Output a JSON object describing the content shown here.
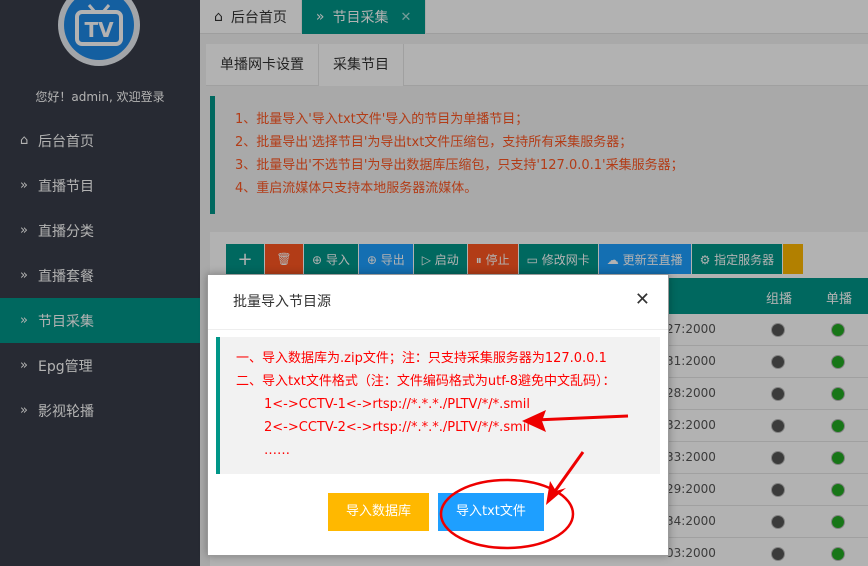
{
  "sidebar": {
    "greeting": "您好！admin, 欢迎登录",
    "items": [
      {
        "label": "后台首页",
        "icon": "home-icon",
        "glyph": "⌂"
      },
      {
        "label": "直播节目",
        "icon": "double-chevron-icon",
        "glyph": "»"
      },
      {
        "label": "直播分类",
        "icon": "double-chevron-icon",
        "glyph": "»"
      },
      {
        "label": "直播套餐",
        "icon": "double-chevron-icon",
        "glyph": "»"
      },
      {
        "label": "节目采集",
        "icon": "double-chevron-icon",
        "glyph": "»",
        "active": true
      },
      {
        "label": "Epg管理",
        "icon": "double-chevron-icon",
        "glyph": "»"
      },
      {
        "label": "影视轮播",
        "icon": "double-chevron-icon",
        "glyph": "»"
      }
    ]
  },
  "tabs": [
    {
      "label": "后台首页",
      "glyph": "⌂"
    },
    {
      "label": "节目采集",
      "glyph": "»",
      "close": "✕",
      "active": true
    }
  ],
  "subtabs": [
    "单播网卡设置",
    "采集节目"
  ],
  "notice": [
    "1、批量导入'导入txt文件'导入的节目为单播节目；",
    "2、批量导出'选择节目'为导出txt文件压缩包，支持所有采集服务器；",
    "3、批量导出'不选节目'为导出数据库压缩包，只支持'127.0.0.1'采集服务器；",
    "4、重启流媒体只支持本地服务器流媒体。"
  ],
  "toolbar": [
    {
      "label": "+",
      "color": "green"
    },
    {
      "label": "🗑",
      "color": "red"
    },
    {
      "label": "⊕ 导入",
      "color": "green"
    },
    {
      "label": "⊕ 导出",
      "color": "blue"
    },
    {
      "label": "▷ 启动",
      "color": "green"
    },
    {
      "label": "⏸ 停止",
      "color": "red"
    },
    {
      "label": "▭ 修改网卡",
      "color": "green"
    },
    {
      "label": "☁ 更新至直播",
      "color": "blue"
    },
    {
      "label": "⚙ 指定服务器",
      "color": "green"
    },
    {
      "label": "",
      "color": "orange"
    }
  ],
  "table": {
    "headers": [
      "组播",
      "单播"
    ],
    "times": [
      "27:2000",
      "31:2000",
      "28:2000",
      "32:2000",
      "33:2000",
      "29:2000",
      "34:2000",
      "03:2000"
    ]
  },
  "dialog": {
    "title": "批量导入节目源",
    "close": "✕",
    "lines": [
      "一、导入数据库为.zip文件；注：只支持采集服务器为127.0.0.1",
      "二、导入txt文件格式（注：文件编码格式为utf-8避免中文乱码）：",
      "1<->CCTV-1<->rtsp://*.*.*./PLTV/*/*.smil",
      "2<->CCTV-2<->rtsp://*.*.*./PLTV/*/*.smil",
      "……"
    ],
    "btn_db": "导入数据库",
    "btn_txt": "导入txt文件"
  },
  "logo_text": "TV"
}
